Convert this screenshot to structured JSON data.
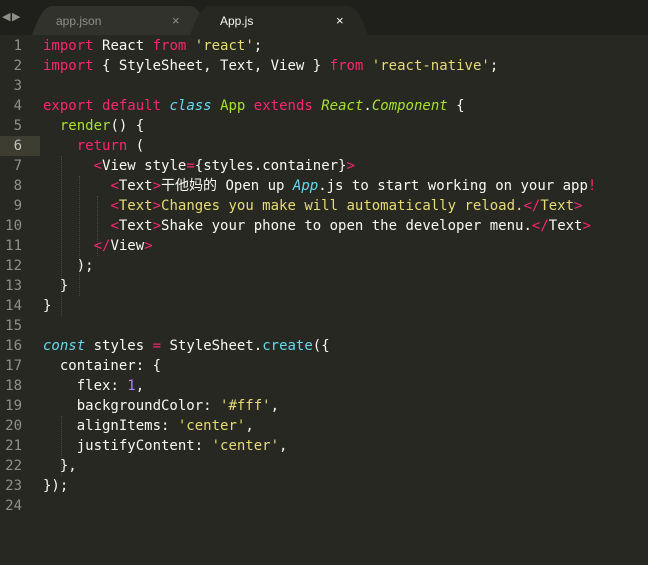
{
  "nav": {
    "back": "◀",
    "forward": "▶"
  },
  "tabs": [
    {
      "label": "app.json",
      "close": "×"
    },
    {
      "label": "App.js",
      "close": "×"
    }
  ],
  "lines": [
    "1",
    "2",
    "3",
    "4",
    "5",
    "6",
    "7",
    "8",
    "9",
    "10",
    "11",
    "12",
    "13",
    "14",
    "15",
    "16",
    "17",
    "18",
    "19",
    "20",
    "21",
    "22",
    "23",
    "24"
  ],
  "code": {
    "l1": {
      "import": "import",
      "react_id": "React",
      "from": "from",
      "module": "'react'",
      "semi": ";"
    },
    "l2": {
      "import": "import",
      "open": "{",
      "names": "StyleSheet, Text, View",
      "close": "}",
      "from": "from",
      "module": "'react-native'",
      "semi": ";"
    },
    "l4": {
      "export": "export",
      "default": "default",
      "class": "class",
      "name": "App",
      "extends": "extends",
      "base": "React",
      "dot": ".",
      "base_member": "Component",
      "brace": "{"
    },
    "l5": {
      "method": "render",
      "rest": "() {"
    },
    "l6": {
      "return": "return",
      "paren": "("
    },
    "l7": {
      "open": "<",
      "tag": "View",
      "attr": "style",
      "eq": "=",
      "expr": "{styles.container}",
      "close": ">"
    },
    "l8": {
      "open": "<",
      "tag": "Text",
      "close": ">",
      "text_a": "干他妈的 Open up ",
      "italic": "App",
      "text_b": ".js to start working on your app",
      "end": "!"
    },
    "l9": {
      "open": "<",
      "tag": "Text",
      "close": ">",
      "text": "Changes you make will automatically reload.",
      "end_open": "</",
      "end_tag": "Text",
      "end_close": ">"
    },
    "l10": {
      "open": "<",
      "tag": "Text",
      "close": ">",
      "text": "Shake your phone to open the developer menu.",
      "end_open": "</",
      "end_tag": "Text",
      "end_close": ">"
    },
    "l11": {
      "end_open": "</",
      "tag": "View",
      "close": ">"
    },
    "l12": {
      "text": ");"
    },
    "l13": {
      "text": "}"
    },
    "l14": {
      "text": "}"
    },
    "l16": {
      "const": "const",
      "name": "styles",
      "eq": "=",
      "obj": "StyleSheet",
      "dot": ".",
      "method": "create",
      "rest": "({"
    },
    "l17": {
      "key": "container",
      "rest": ": {"
    },
    "l18": {
      "key": "flex",
      "colon": ": ",
      "value": "1",
      "comma": ","
    },
    "l19": {
      "key": "backgroundColor",
      "colon": ": ",
      "value": "'#fff'",
      "comma": ","
    },
    "l20": {
      "key": "alignItems",
      "colon": ": ",
      "value": "'center'",
      "comma": ","
    },
    "l21": {
      "key": "justifyContent",
      "colon": ": ",
      "value": "'center'",
      "comma": ","
    },
    "l22": {
      "text": "},"
    },
    "l23": {
      "text": "});"
    }
  },
  "colors": {
    "background": "#272822",
    "keyword": "#f92672",
    "string": "#e6db74",
    "function": "#66d9ef",
    "class": "#a6e22e",
    "number": "#ae81ff",
    "text": "#f8f8f2"
  }
}
